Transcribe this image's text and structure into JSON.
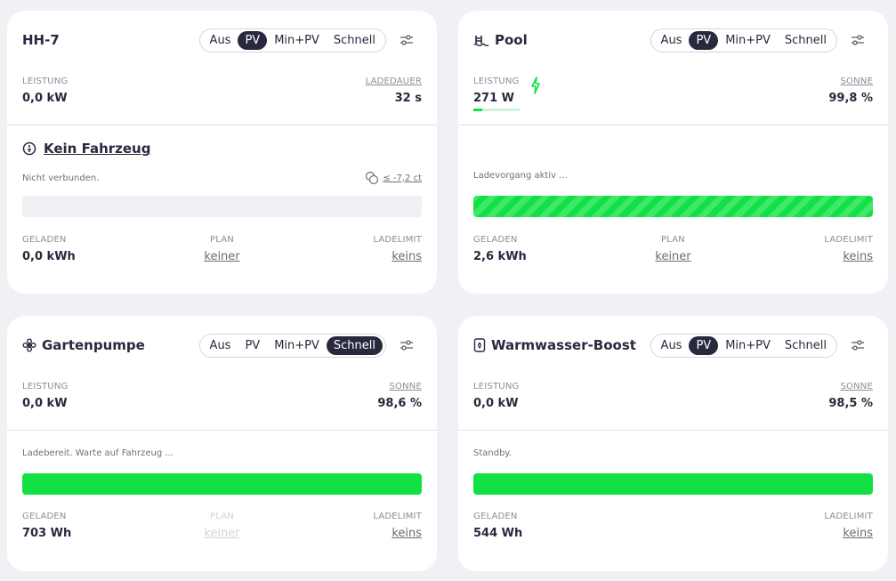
{
  "cards": [
    {
      "title": "HH-7",
      "icon": "",
      "modes": [
        "Aus",
        "PV",
        "Min+PV",
        "Schnell"
      ],
      "active_mode": "PV",
      "left_label": "LEISTUNG",
      "left_value": "0,0 kW",
      "right_label": "LADEDAUER",
      "right_value": "32 s",
      "vehicle": "Kein Fahrzeug",
      "status": "Nicht verbunden.",
      "price": "≤ -7,2 ct",
      "bar": "empty",
      "charged_label": "GELADEN",
      "charged_value": "0,0 kWh",
      "plan_label": "PLAN",
      "plan_value": "keiner",
      "limit_label": "LADELIMIT",
      "limit_value": "keins"
    },
    {
      "title": "Pool",
      "icon": "pool-icon",
      "modes": [
        "Aus",
        "PV",
        "Min+PV",
        "Schnell"
      ],
      "active_mode": "PV",
      "left_label": "LEISTUNG",
      "left_value": "271 W",
      "right_label": "SONNE",
      "right_value": "99,8 %",
      "status": "Ladevorgang aktiv ...",
      "bar": "striped",
      "charged_label": "GELADEN",
      "charged_value": "2,6 kWh",
      "plan_label": "PLAN",
      "plan_value": "keiner",
      "limit_label": "LADELIMIT",
      "limit_value": "keins"
    },
    {
      "title": "Gartenpumpe",
      "icon": "flower-icon",
      "modes": [
        "Aus",
        "PV",
        "Min+PV",
        "Schnell"
      ],
      "active_mode": "Schnell",
      "left_label": "LEISTUNG",
      "left_value": "0,0 kW",
      "right_label": "SONNE",
      "right_value": "98,6 %",
      "status": "Ladebereit. Warte auf Fahrzeug ...",
      "bar": "full",
      "charged_label": "GELADEN",
      "charged_value": "703 Wh",
      "plan_label": "PLAN",
      "plan_value": "keiner",
      "limit_label": "LADELIMIT",
      "limit_value": "keins"
    },
    {
      "title": "Warmwasser-Boost",
      "icon": "water-heater-icon",
      "modes": [
        "Aus",
        "PV",
        "Min+PV",
        "Schnell"
      ],
      "active_mode": "PV",
      "left_label": "LEISTUNG",
      "left_value": "0,0 kW",
      "right_label": "SONNE",
      "right_value": "98,5 %",
      "status": "Standby.",
      "bar": "full",
      "charged_label": "GELADEN",
      "charged_value": "544 Wh",
      "limit_label": "LADELIMIT",
      "limit_value": "keins"
    }
  ],
  "colors": {
    "accent": "#12e045",
    "dark": "#28293e",
    "background": "#f1f1f5"
  }
}
